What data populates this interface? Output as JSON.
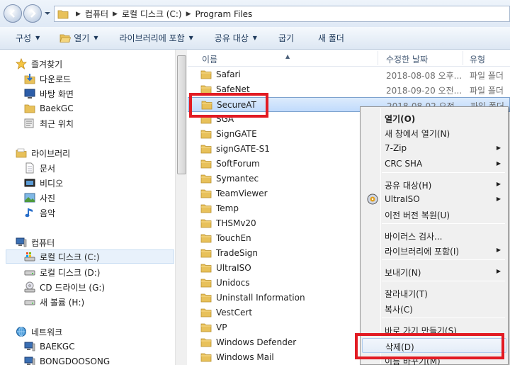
{
  "address": {
    "crumbs": [
      "컴퓨터",
      "로컬 디스크 (C:)",
      "Program Files"
    ]
  },
  "toolbar": {
    "items": [
      {
        "label": "구성",
        "dropdown": true
      },
      {
        "label": "열기",
        "dropdown": true,
        "icon": "folder-open-icon"
      },
      {
        "label": "라이브러리에 포함",
        "dropdown": true
      },
      {
        "label": "공유 대상",
        "dropdown": true
      },
      {
        "label": "굽기",
        "dropdown": false
      },
      {
        "label": "새 폴더",
        "dropdown": false
      }
    ]
  },
  "nav": {
    "favorites": {
      "header": "즐겨찾기",
      "items": [
        "다운로드",
        "바탕 화면",
        "BaekGC",
        "최근 위치"
      ]
    },
    "libraries": {
      "header": "라이브러리",
      "items": [
        "문서",
        "비디오",
        "사진",
        "음악"
      ]
    },
    "computer": {
      "header": "컴퓨터",
      "items": [
        "로컬 디스크 (C:)",
        "로컬 디스크 (D:)",
        "CD 드라이브 (G:)",
        "새 볼륨 (H:)"
      ]
    },
    "network": {
      "header": "네트워크",
      "items": [
        "BAEKGC",
        "BONGDOOSONG"
      ]
    }
  },
  "columns": {
    "name": "이름",
    "date": "수정한 날짜",
    "type": "유형"
  },
  "files": [
    {
      "name": "Safari",
      "date": "2018-08-08 오후...",
      "type": "파일 폴더"
    },
    {
      "name": "SafeNet",
      "date": "2018-09-20 오전...",
      "type": "파일 폴더"
    },
    {
      "name": "SecureAT",
      "date": "2018-08-02 오전...",
      "type": "파일 폴더"
    },
    {
      "name": "SGA",
      "date": "",
      "type": ""
    },
    {
      "name": "SignGATE",
      "date": "",
      "type": ""
    },
    {
      "name": "signGATE-S1",
      "date": "",
      "type": ""
    },
    {
      "name": "SoftForum",
      "date": "",
      "type": ""
    },
    {
      "name": "Symantec",
      "date": "",
      "type": ""
    },
    {
      "name": "TeamViewer",
      "date": "",
      "type": ""
    },
    {
      "name": "Temp",
      "date": "",
      "type": ""
    },
    {
      "name": "THSMv20",
      "date": "",
      "type": ""
    },
    {
      "name": "TouchEn",
      "date": "",
      "type": ""
    },
    {
      "name": "TradeSign",
      "date": "",
      "type": ""
    },
    {
      "name": "UltraISO",
      "date": "",
      "type": ""
    },
    {
      "name": "Unidocs",
      "date": "",
      "type": ""
    },
    {
      "name": "Uninstall Information",
      "date": "",
      "type": ""
    },
    {
      "name": "VestCert",
      "date": "",
      "type": ""
    },
    {
      "name": "VP",
      "date": "",
      "type": ""
    },
    {
      "name": "Windows Defender",
      "date": "",
      "type": ""
    },
    {
      "name": "Windows Mail",
      "date": "",
      "type": ""
    }
  ],
  "context_menu": {
    "items": [
      {
        "label": "열기(O)",
        "bold": true
      },
      {
        "label": "새 창에서 열기(N)"
      },
      {
        "label": "7-Zip",
        "submenu": true
      },
      {
        "label": "CRC SHA",
        "submenu": true
      },
      {
        "label": "공유 대상(H)",
        "submenu": true
      },
      {
        "label": "UltraISO",
        "submenu": true,
        "icon": "ultraiso-icon"
      },
      {
        "label": "이전 버전 복원(U)"
      },
      {
        "label": "바이러스 검사..."
      },
      {
        "label": "라이브러리에 포함(I)",
        "submenu": true
      },
      {
        "label": "보내기(N)",
        "submenu": true
      },
      {
        "label": "잘라내기(T)"
      },
      {
        "label": "복사(C)"
      },
      {
        "label": "바로 가기 만들기(S)"
      },
      {
        "label": "삭제(D)",
        "highlighted": true
      },
      {
        "label": "이름 바꾸기(M)"
      }
    ]
  },
  "colors": {
    "highlight_box": "#e21b23",
    "folder": "#e8c15a",
    "selection": "#c1dbfc"
  }
}
